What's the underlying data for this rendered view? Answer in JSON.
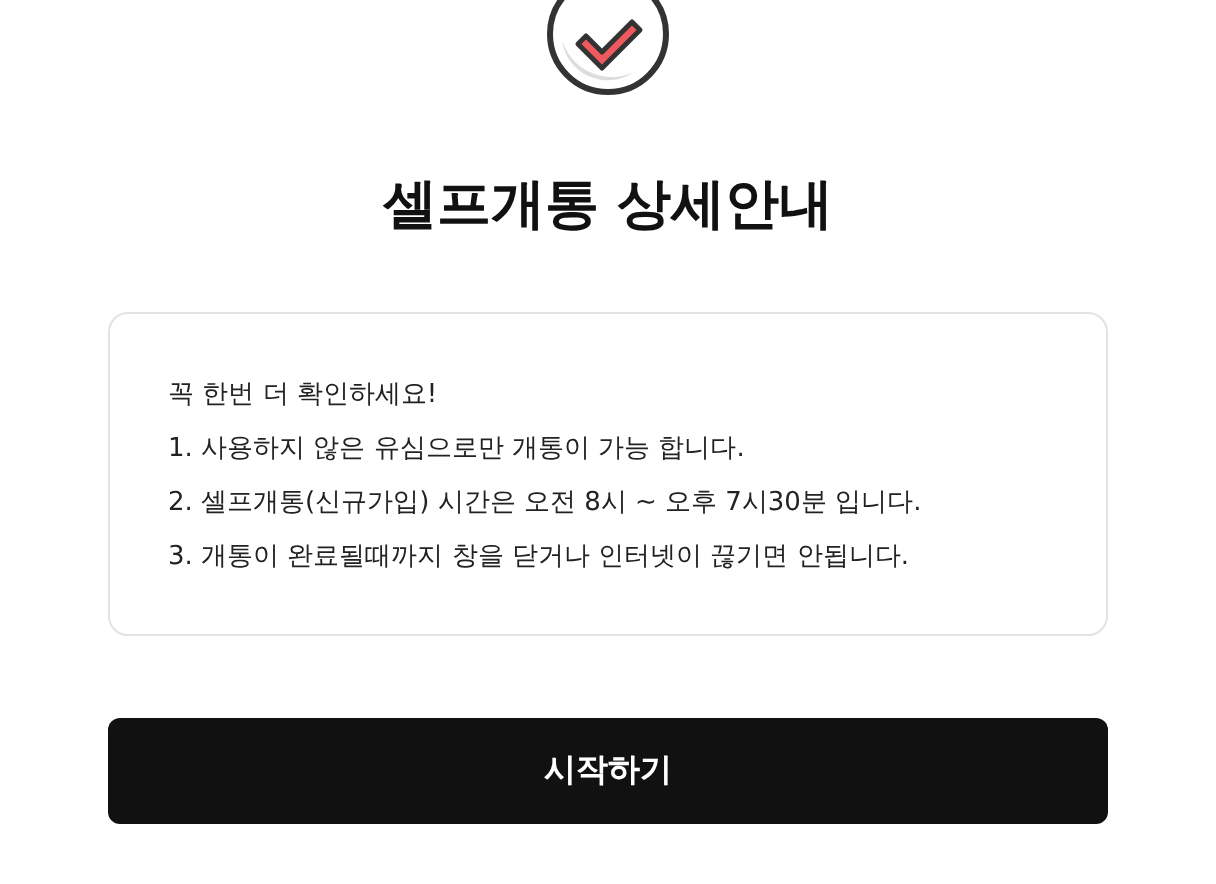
{
  "title": "셀프개통 상세안내",
  "notice": {
    "heading": "꼭 한번 더 확인하세요!",
    "items": [
      "1. 사용하지 않은 유심으로만 개통이 가능 합니다.",
      "2. 셀프개통(신규가입) 시간은 오전 8시 ~ 오후 7시30분 입니다.",
      "3. 개통이 완료될때까지 창을 닫거나 인터넷이 끊기면 안됩니다."
    ]
  },
  "button": "시작하기"
}
